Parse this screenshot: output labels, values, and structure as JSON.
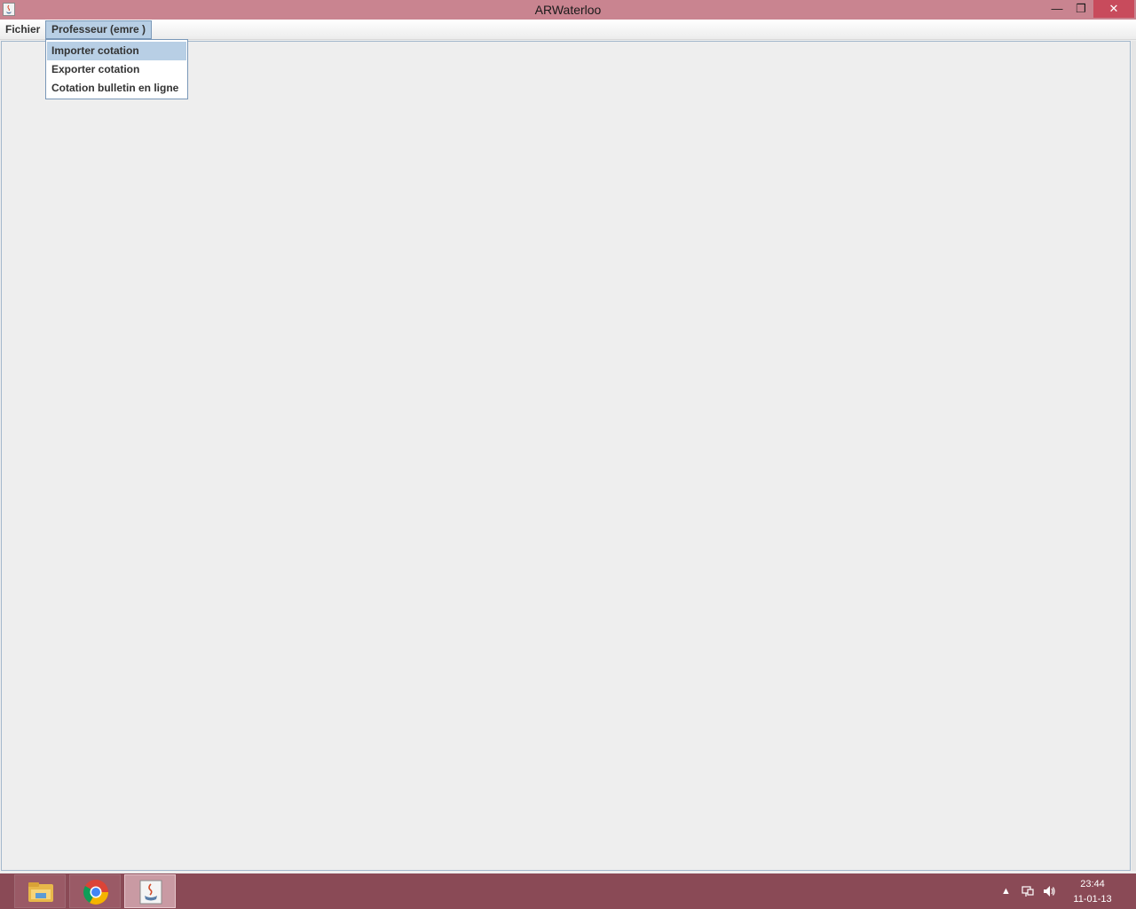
{
  "window": {
    "title": "ARWaterloo",
    "minimize_glyph": "—",
    "maximize_glyph": "❐",
    "close_glyph": "✕"
  },
  "menubar": {
    "items": [
      {
        "label": "Fichier"
      },
      {
        "label": "Professeur (emre )"
      }
    ]
  },
  "dropdown": {
    "items": [
      {
        "label": "Importer cotation",
        "highlighted": true
      },
      {
        "label": "Exporter cotation"
      },
      {
        "label": "Cotation bulletin en ligne"
      }
    ]
  },
  "taskbar": {
    "apps": [
      "file-explorer-icon",
      "chrome-icon",
      "java-icon"
    ],
    "tray": {
      "arrow": "▲",
      "time": "23:44",
      "date": "11-01-13"
    }
  },
  "colors": {
    "accent": "#c98490",
    "taskbar": "#8a4a56",
    "menu_highlight": "#b8cfe5"
  }
}
